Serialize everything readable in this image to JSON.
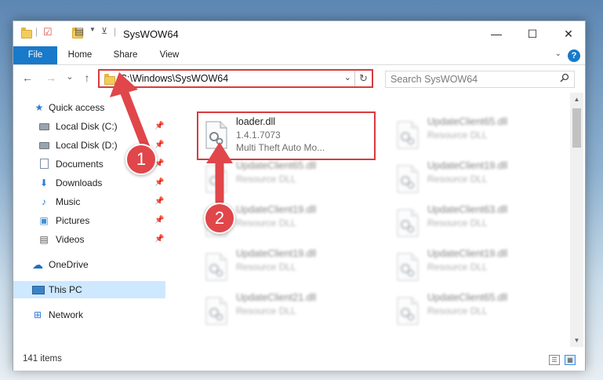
{
  "window": {
    "title": "SysWOW64",
    "controls": {
      "minimize": "—",
      "maximize": "☐",
      "close": "✕"
    }
  },
  "ribbon": {
    "tabs": [
      "File",
      "Home",
      "Share",
      "View"
    ],
    "expand_icon": "chevron-down-icon",
    "help_label": "?"
  },
  "navbar": {
    "back_icon": "←",
    "forward_icon": "→",
    "recent_icon": "⌄",
    "up_icon": "↑",
    "address": "C:\\Windows\\SysWOW64",
    "refresh_icon": "↻",
    "search_placeholder": "Search SysWOW64",
    "search_icon": "⌕"
  },
  "sidebar": {
    "items": [
      {
        "label": "Quick access",
        "icon": "star-icon",
        "glyph": "★",
        "pinned": false
      },
      {
        "label": "Local Disk (C:)",
        "icon": "drive-icon",
        "pinned": true
      },
      {
        "label": "Local Disk (D:)",
        "icon": "drive-icon",
        "pinned": true
      },
      {
        "label": "Documents",
        "icon": "documents-icon",
        "pinned": true
      },
      {
        "label": "Downloads",
        "icon": "downloads-icon",
        "glyph": "⬇",
        "pinned": true
      },
      {
        "label": "Music",
        "icon": "music-icon",
        "glyph": "♪",
        "pinned": true
      },
      {
        "label": "Pictures",
        "icon": "pictures-icon",
        "glyph": "▣",
        "pinned": true
      },
      {
        "label": "Videos",
        "icon": "videos-icon",
        "glyph": "▤",
        "pinned": true
      },
      {
        "label": "OneDrive",
        "icon": "onedrive-icon",
        "glyph": "☁",
        "pinned": false
      },
      {
        "label": "This PC",
        "icon": "this-pc-icon",
        "pinned": false,
        "selected": true
      },
      {
        "label": "Network",
        "icon": "network-icon",
        "glyph": "⊞",
        "pinned": false
      }
    ],
    "pin_glyph": "📌"
  },
  "files": [
    {
      "name": "loader.dll",
      "line2": "1.4.1.7073",
      "line3": "Multi Theft Auto Mo...",
      "highlighted": true
    },
    {
      "name": "UpdateClient65.dll",
      "line2": "Resource DLL",
      "blurred": true
    },
    {
      "name": "UpdateClient65.dll",
      "line2": "Resource DLL",
      "blurred": true
    },
    {
      "name": "UpdateClient19.dll",
      "line2": "Resource DLL",
      "blurred": true
    },
    {
      "name": "UpdateClient19.dll",
      "line2": "Resource DLL",
      "blurred": true
    },
    {
      "name": "UpdateClient63.dll",
      "line2": "Resource DLL",
      "blurred": true
    },
    {
      "name": "UpdateClient19.dll",
      "line2": "Resource DLL",
      "blurred": true
    },
    {
      "name": "UpdateClient19.dll",
      "line2": "Resource DLL",
      "blurred": true
    },
    {
      "name": "UpdateClient21.dll",
      "line2": "Resource DLL",
      "blurred": true
    },
    {
      "name": "UpdateClient65.dll",
      "line2": "Resource DLL",
      "blurred": true
    }
  ],
  "statusbar": {
    "item_count": "141 items"
  },
  "annotations": {
    "step1": "1",
    "step2": "2",
    "color": "#e0464a"
  },
  "colors": {
    "accent": "#1979ca",
    "highlight": "#d93a3e",
    "selected": "#cde8ff"
  }
}
